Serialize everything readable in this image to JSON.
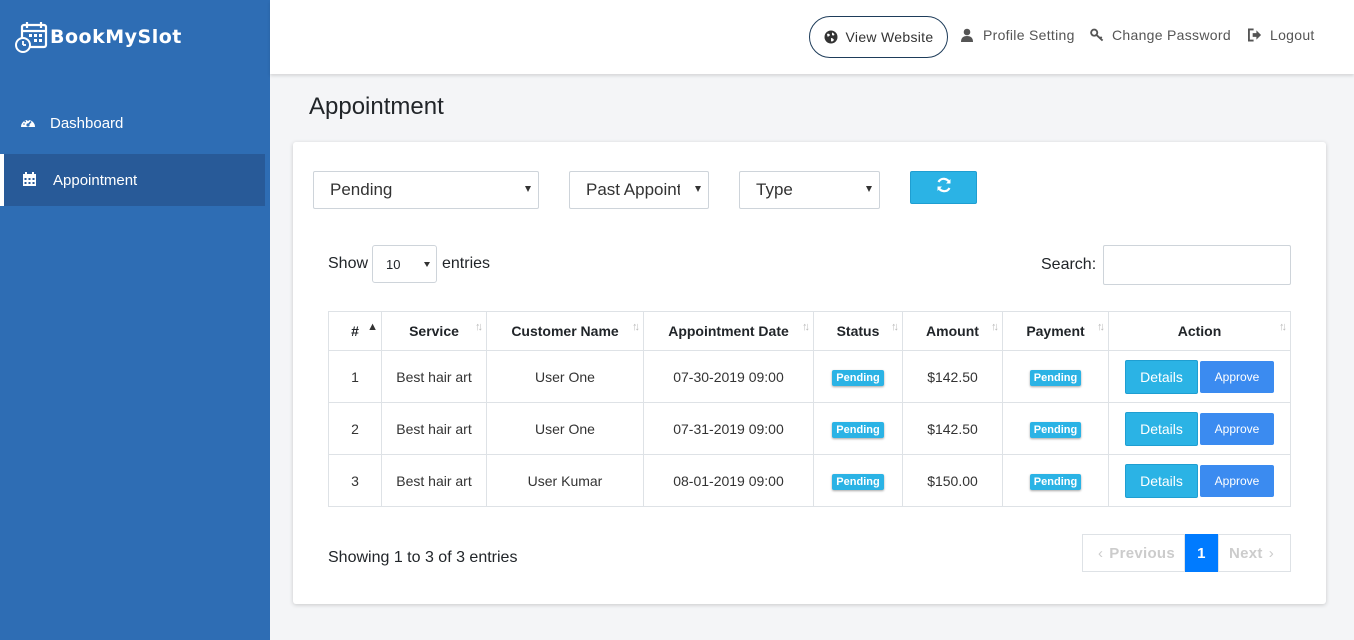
{
  "brand": {
    "name": "BookMySlot"
  },
  "sidebar": {
    "items": [
      {
        "label": "Dashboard",
        "icon": "dashboard-icon"
      },
      {
        "label": "Appointment",
        "icon": "calendar-icon",
        "active": true
      }
    ]
  },
  "topbar": {
    "view_website": "View Website",
    "profile_setting": "Profile Setting",
    "change_password": "Change Password",
    "logout": "Logout"
  },
  "page": {
    "title": "Appointment"
  },
  "filters": {
    "status": "Pending",
    "time": "Past Appointments",
    "type": "Type"
  },
  "table_controls": {
    "show": "Show",
    "page_size": "10",
    "entries": "entries",
    "search_label": "Search:",
    "search_value": ""
  },
  "table": {
    "headers": [
      "#",
      "Service",
      "Customer Name",
      "Appointment Date",
      "Status",
      "Amount",
      "Payment",
      "Action"
    ],
    "rows": [
      {
        "num": "1",
        "service": "Best hair art",
        "customer": "User One",
        "date": "07-30-2019 09:00",
        "status": "Pending",
        "amount": "$142.50",
        "payment": "Pending",
        "details": "Details",
        "approve": "Approve"
      },
      {
        "num": "2",
        "service": "Best hair art",
        "customer": "User One",
        "date": "07-31-2019 09:00",
        "status": "Pending",
        "amount": "$142.50",
        "payment": "Pending",
        "details": "Details",
        "approve": "Approve"
      },
      {
        "num": "3",
        "service": "Best hair art",
        "customer": "User Kumar",
        "date": "08-01-2019 09:00",
        "status": "Pending",
        "amount": "$150.00",
        "payment": "Pending",
        "details": "Details",
        "approve": "Approve"
      }
    ]
  },
  "footer": {
    "info": "Showing 1 to 3 of 3 entries",
    "previous": "Previous",
    "current_page": "1",
    "next": "Next"
  },
  "colors": {
    "sidebar": "#2e6db4",
    "sidebar_active": "#285a98",
    "accent": "#2bb3e5",
    "approve": "#3b8bf0",
    "page_active": "#007bff"
  }
}
